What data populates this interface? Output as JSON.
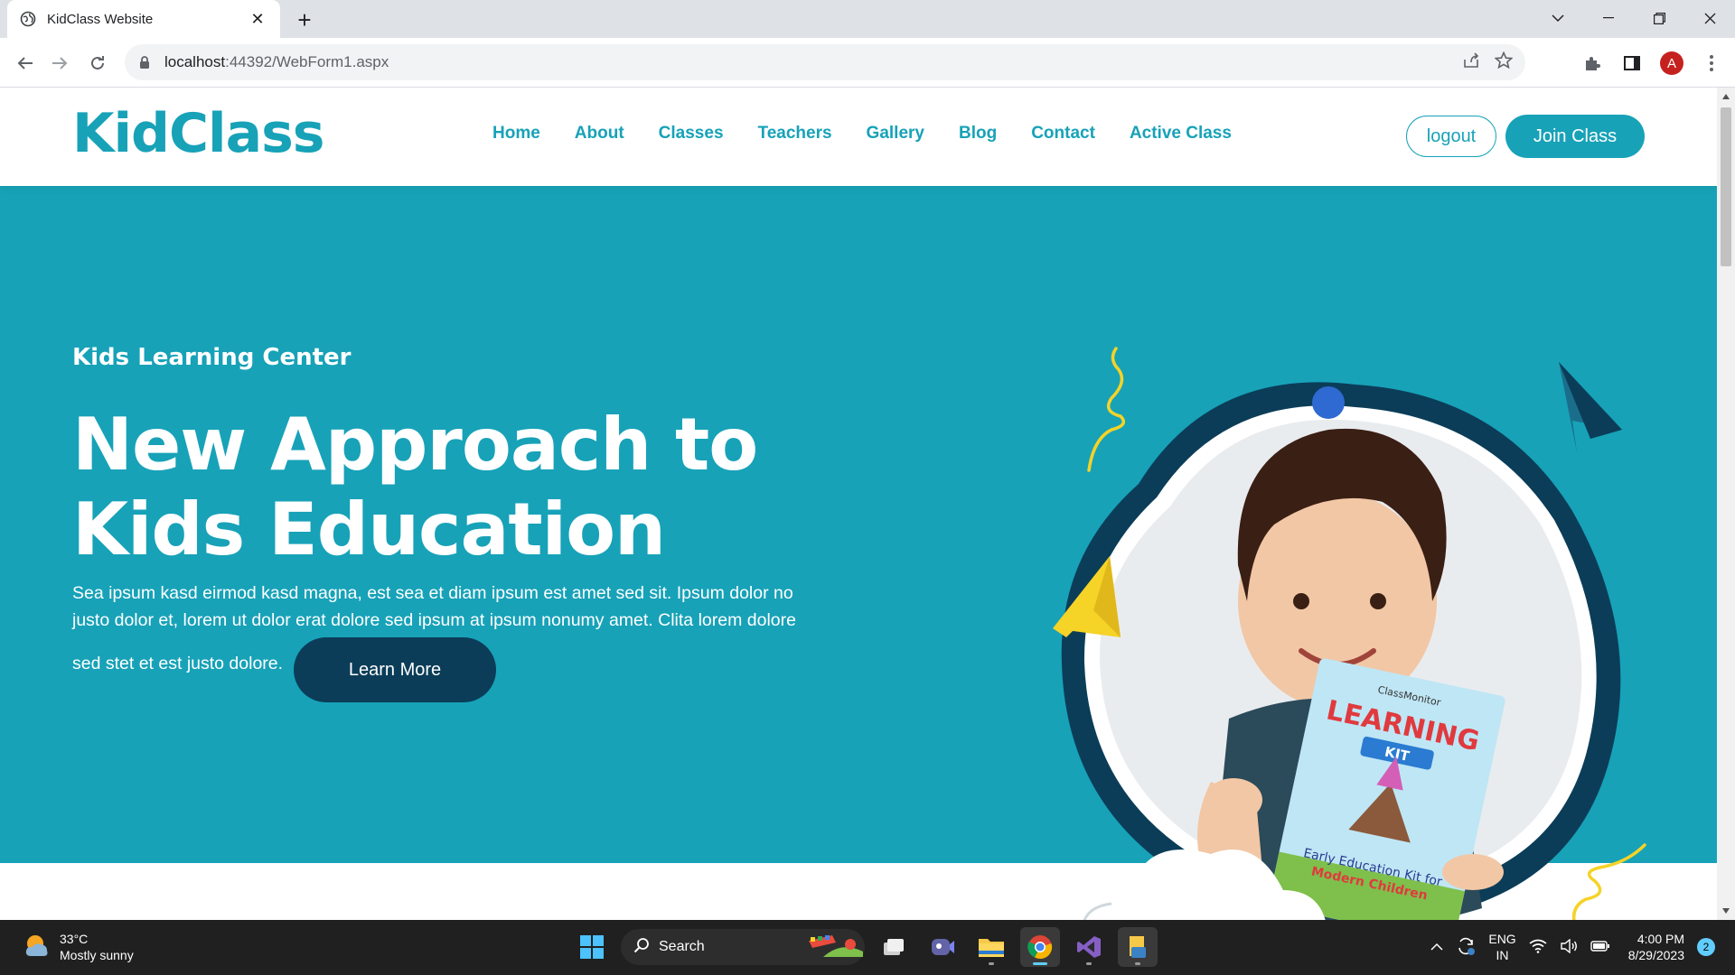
{
  "browser": {
    "tab_title": "KidClass Website",
    "url_host": "localhost",
    "url_rest": ":44392/WebForm1.aspx",
    "profile_initial": "A"
  },
  "site": {
    "logo": "KidClass",
    "menu": [
      "Home",
      "About",
      "Classes",
      "Teachers",
      "Gallery",
      "Blog",
      "Contact",
      "Active Class"
    ],
    "logout_label": "logout",
    "join_label": "Join Class"
  },
  "hero": {
    "subtitle": "Kids Learning Center",
    "title_line1": "New Approach to",
    "title_line2": "Kids Education",
    "paragraph": "Sea ipsum kasd eirmod kasd magna, est sea et diam ipsum est amet sed sit. Ipsum dolor no justo dolor et, lorem ut dolor erat dolore sed ipsum at ipsum nonumy amet. Clita lorem dolore",
    "paragraph_end": "sed stet et est justo dolore.",
    "learn_more": "Learn More",
    "book_title": "LEARNING",
    "book_kit": "KIT",
    "book_brand": "ClassMonitor",
    "book_caption_1": "Early Education Kit for",
    "book_caption_2": "Modern Children"
  },
  "taskbar": {
    "temperature": "33°C",
    "weather": "Mostly sunny",
    "search": "Search",
    "lang_1": "ENG",
    "lang_2": "IN",
    "time": "4:00 PM",
    "date": "8/29/2023",
    "notifications": "2"
  },
  "colors": {
    "primary": "#17a2b8",
    "dark": "#0b3d58",
    "accent_yellow": "#f5d327"
  }
}
